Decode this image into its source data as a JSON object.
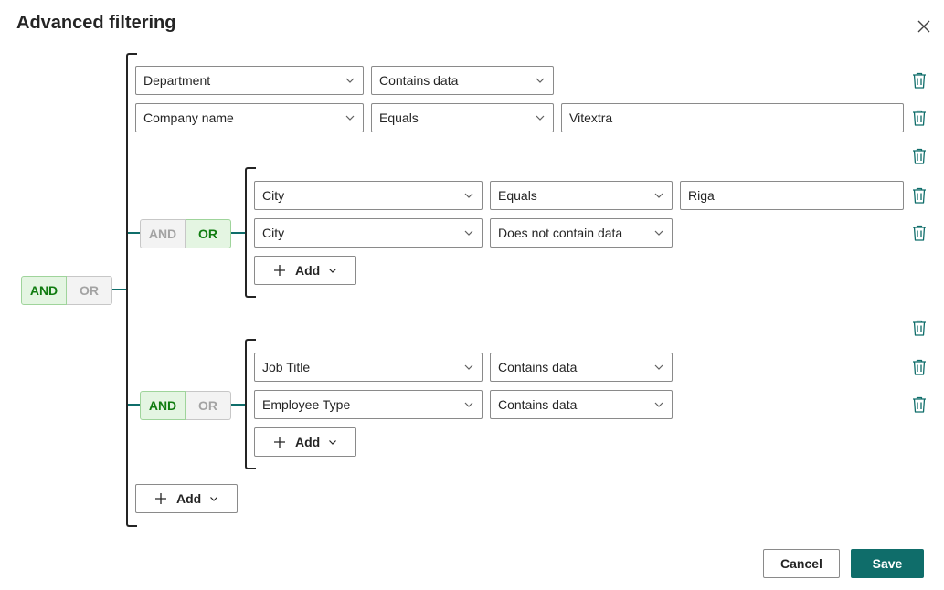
{
  "dialog": {
    "title": "Advanced filtering",
    "close_icon": "close-icon"
  },
  "logic": {
    "and_label": "AND",
    "or_label": "OR",
    "root_selected": "AND",
    "group1_selected": "OR",
    "group2_selected": "AND"
  },
  "rows": {
    "r1": {
      "field": "Department",
      "operator": "Contains data"
    },
    "r2": {
      "field": "Company name",
      "operator": "Equals",
      "value": "Vitextra"
    },
    "g1r1": {
      "field": "City",
      "operator": "Equals",
      "value": "Riga"
    },
    "g1r2": {
      "field": "City",
      "operator": "Does not contain data"
    },
    "g2r1": {
      "field": "Job Title",
      "operator": "Contains data"
    },
    "g2r2": {
      "field": "Employee Type",
      "operator": "Contains data"
    }
  },
  "add_label": "Add",
  "footer": {
    "cancel_label": "Cancel",
    "save_label": "Save"
  },
  "colors": {
    "accent": "#0f6d6a",
    "selected_bg": "#e4f5e2",
    "selected_text": "#107c10"
  }
}
